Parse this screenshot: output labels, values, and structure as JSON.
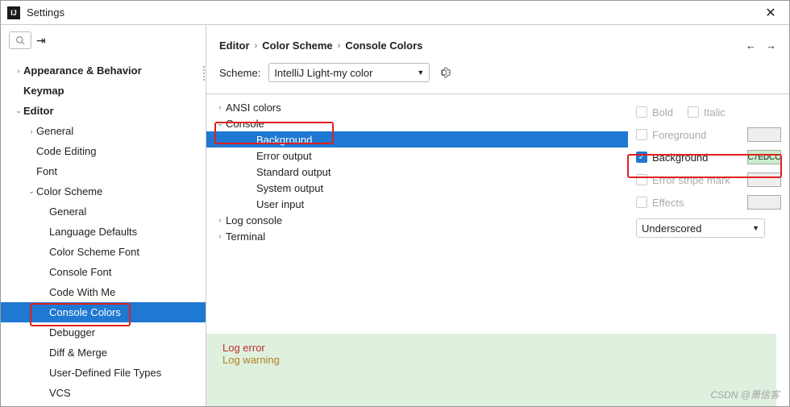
{
  "window": {
    "title": "Settings"
  },
  "breadcrumb": {
    "p0": "Editor",
    "p1": "Color Scheme",
    "p2": "Console Colors"
  },
  "scheme": {
    "label": "Scheme:",
    "value": "IntelliJ Light-my color"
  },
  "sidebar": {
    "items": [
      {
        "label": "Appearance & Behavior",
        "bold": true,
        "arrow": ">",
        "pad": 0
      },
      {
        "label": "Keymap",
        "bold": true,
        "arrow": "",
        "pad": 0
      },
      {
        "label": "Editor",
        "bold": true,
        "arrow": "v",
        "pad": 0
      },
      {
        "label": "General",
        "arrow": ">",
        "pad": 1
      },
      {
        "label": "Code Editing",
        "arrow": "",
        "pad": 1
      },
      {
        "label": "Font",
        "arrow": "",
        "pad": 1
      },
      {
        "label": "Color Scheme",
        "arrow": "v",
        "pad": 1
      },
      {
        "label": "General",
        "arrow": "",
        "pad": 2
      },
      {
        "label": "Language Defaults",
        "arrow": "",
        "pad": 2
      },
      {
        "label": "Color Scheme Font",
        "arrow": "",
        "pad": 2
      },
      {
        "label": "Console Font",
        "arrow": "",
        "pad": 2
      },
      {
        "label": "Code With Me",
        "arrow": "",
        "pad": 2
      },
      {
        "label": "Console Colors",
        "arrow": "",
        "pad": 2,
        "selected": true
      },
      {
        "label": "Debugger",
        "arrow": "",
        "pad": 2
      },
      {
        "label": "Diff & Merge",
        "arrow": "",
        "pad": 2
      },
      {
        "label": "User-Defined File Types",
        "arrow": "",
        "pad": 2
      },
      {
        "label": "VCS",
        "arrow": "",
        "pad": 2
      }
    ]
  },
  "color_tree": [
    {
      "label": "ANSI colors",
      "arrow": ">",
      "pad": 0
    },
    {
      "label": "Console",
      "arrow": "v",
      "pad": 0
    },
    {
      "label": "Background",
      "arrow": "",
      "pad": 2,
      "selected": true
    },
    {
      "label": "Error output",
      "arrow": "",
      "pad": 2
    },
    {
      "label": "Standard output",
      "arrow": "",
      "pad": 2
    },
    {
      "label": "System output",
      "arrow": "",
      "pad": 2
    },
    {
      "label": "User input",
      "arrow": "",
      "pad": 2
    },
    {
      "label": "Log console",
      "arrow": ">",
      "pad": 0
    },
    {
      "label": "Terminal",
      "arrow": ">",
      "pad": 0
    }
  ],
  "options": {
    "bold": "Bold",
    "italic": "Italic",
    "foreground": "Foreground",
    "background": "Background",
    "background_value": "C7EDCC",
    "error_stripe": "Error stripe mark",
    "effects": "Effects",
    "effects_type": "Underscored"
  },
  "preview": {
    "log_error": "Log error",
    "log_warning": "Log warning"
  },
  "watermark": "CSDN @萧信客"
}
